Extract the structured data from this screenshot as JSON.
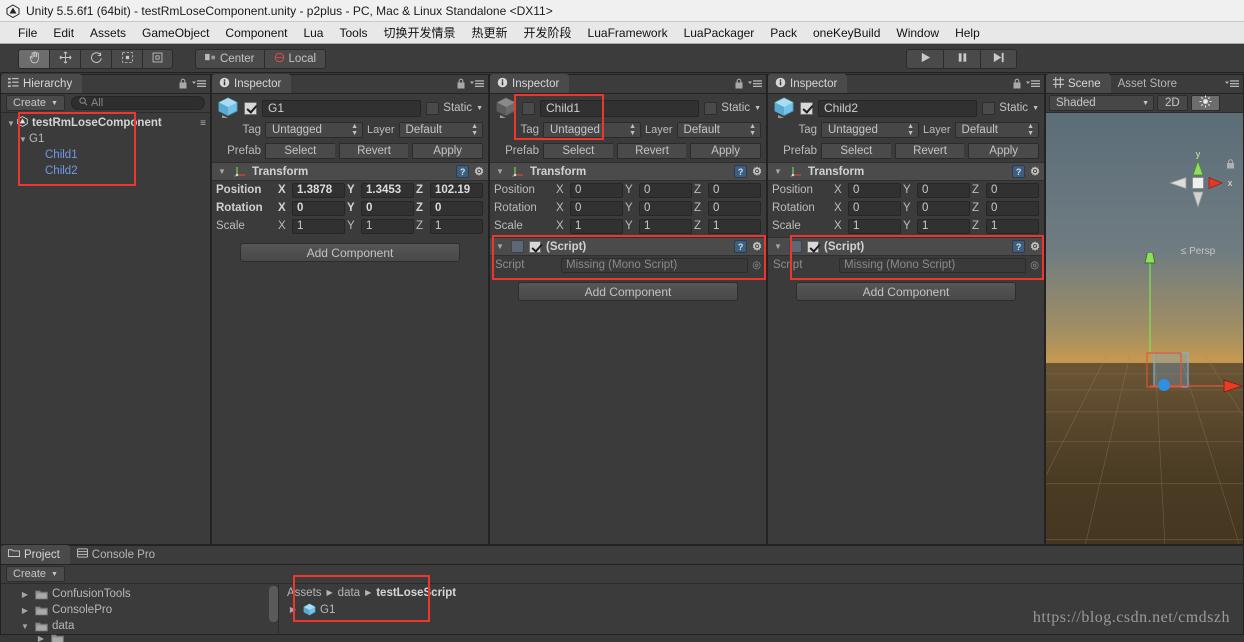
{
  "window": {
    "title": "Unity 5.5.6f1 (64bit) - testRmLoseComponent.unity - p2plus - PC, Mac & Linux Standalone <DX11>",
    "logo_icon": "unity-logo-icon"
  },
  "menu": {
    "items": [
      "File",
      "Edit",
      "Assets",
      "GameObject",
      "Component",
      "Lua",
      "Tools",
      "切换开发情景",
      "热更新",
      "开发阶段",
      "LuaFramework",
      "LuaPackager",
      "Pack",
      "oneKeyBuild",
      "Window",
      "Help"
    ]
  },
  "toolbar": {
    "tools": [
      {
        "name": "hand-tool",
        "icon": "hand-icon",
        "active": true
      },
      {
        "name": "move-tool",
        "icon": "move-arrows-icon",
        "active": false
      },
      {
        "name": "rotate-tool",
        "icon": "rotate-icon",
        "active": false
      },
      {
        "name": "scale-tool",
        "icon": "scale-icon",
        "active": false
      },
      {
        "name": "rect-tool",
        "icon": "rect-transform-icon",
        "active": false
      }
    ],
    "pivot_label": "Center",
    "pivot_icon": "pivot-center-icon",
    "rotation_label": "Local",
    "rotation_icon": "local-rotation-icon",
    "play_label": "play-icon",
    "pause_label": "pause-icon",
    "step_label": "step-icon"
  },
  "hierarchy": {
    "tab_label": "Hierarchy",
    "tab_icon": "hierarchy-icon",
    "create_label": "Create",
    "search_placeholder": "All",
    "search_icon": "search-icon",
    "lock_icon": "lock-icon",
    "menu_icon": "panel-menu-icon",
    "scene_name": "testRmLoseComponent",
    "scene_icon": "unity-scene-icon",
    "nodes": [
      {
        "label": "G1",
        "depth": 1,
        "expanded": true,
        "prefab": false
      },
      {
        "label": "Child1",
        "depth": 2,
        "expanded": false,
        "prefab": true
      },
      {
        "label": "Child2",
        "depth": 2,
        "expanded": false,
        "prefab": true
      }
    ]
  },
  "inspectors": [
    {
      "tab_label": "Inspector",
      "tab_icon": "info-icon",
      "object_name": "G1",
      "enabled": true,
      "static_label": "Static",
      "static_checked": false,
      "tag_label": "Tag",
      "tag_value": "Untagged",
      "layer_label": "Layer",
      "layer_value": "Default",
      "prefab_label": "Prefab",
      "prefab_buttons": [
        "Select",
        "Revert",
        "Apply"
      ],
      "transform": {
        "title": "Transform",
        "icon": "transform-axis-icon",
        "rows": [
          {
            "label": "Position",
            "x": "1.3878",
            "y": "1.3453",
            "z": "102.19",
            "highlight": true
          },
          {
            "label": "Rotation",
            "x": "0",
            "y": "0",
            "z": "0",
            "highlight": true
          },
          {
            "label": "Scale",
            "x": "1",
            "y": "1",
            "z": "1",
            "highlight": false
          }
        ]
      },
      "script_component": null,
      "add_component_label": "Add Component"
    },
    {
      "tab_label": "Inspector",
      "tab_icon": "info-icon",
      "object_name": "Child1",
      "enabled": false,
      "static_label": "Static",
      "static_checked": false,
      "tag_label": "Tag",
      "tag_value": "Untagged",
      "layer_label": "Layer",
      "layer_value": "Default",
      "prefab_label": "Prefab",
      "prefab_buttons": [
        "Select",
        "Revert",
        "Apply"
      ],
      "transform": {
        "title": "Transform",
        "icon": "transform-axis-icon",
        "rows": [
          {
            "label": "Position",
            "x": "0",
            "y": "0",
            "z": "0",
            "highlight": false
          },
          {
            "label": "Rotation",
            "x": "0",
            "y": "0",
            "z": "0",
            "highlight": false
          },
          {
            "label": "Scale",
            "x": "1",
            "y": "1",
            "z": "1",
            "highlight": false
          }
        ]
      },
      "script_component": {
        "title": "(Script)",
        "enabled": true,
        "field_label": "Script",
        "field_value": "Missing (Mono Script)"
      },
      "add_component_label": "Add Component"
    },
    {
      "tab_label": "Inspector",
      "tab_icon": "info-icon",
      "object_name": "Child2",
      "enabled": true,
      "static_label": "Static",
      "static_checked": false,
      "tag_label": "Tag",
      "tag_value": "Untagged",
      "layer_label": "Layer",
      "layer_value": "Default",
      "prefab_label": "Prefab",
      "prefab_buttons": [
        "Select",
        "Revert",
        "Apply"
      ],
      "transform": {
        "title": "Transform",
        "icon": "transform-axis-icon",
        "rows": [
          {
            "label": "Position",
            "x": "0",
            "y": "0",
            "z": "0",
            "highlight": false
          },
          {
            "label": "Rotation",
            "x": "0",
            "y": "0",
            "z": "0",
            "highlight": false
          },
          {
            "label": "Scale",
            "x": "1",
            "y": "1",
            "z": "1",
            "highlight": false
          }
        ]
      },
      "script_component": {
        "title": "(Script)",
        "enabled": true,
        "field_label": "Script",
        "field_value": "Missing (Mono Script)"
      },
      "add_component_label": "Add Component"
    }
  ],
  "scene": {
    "tab_label": "Scene",
    "tab_icon": "scene-grid-icon",
    "asset_store_tab": "Asset Store",
    "shading_mode": "Shaded",
    "toggle_2d": "2D",
    "light_icon": "lighting-icon",
    "audio_icon": "audio-icon",
    "perspective_label": "Persp",
    "gizmo_axes": {
      "x": "x",
      "y": "y"
    },
    "lock_icon": "lock-icon"
  },
  "project": {
    "tab_label": "Project",
    "tab_icon": "folder-icon",
    "console_tab": "Console Pro",
    "console_icon": "console-icon",
    "create_label": "Create",
    "tree": [
      {
        "label": "ConfusionTools",
        "expanded": false,
        "depth": 1
      },
      {
        "label": "ConsolePro",
        "expanded": false,
        "depth": 1
      },
      {
        "label": "data",
        "expanded": true,
        "depth": 1
      }
    ],
    "breadcrumb": [
      "Assets",
      "data",
      "testLoseScript"
    ],
    "assets": [
      {
        "label": "G1",
        "icon": "prefab-cube-icon",
        "expandable": true
      }
    ]
  },
  "watermark": "https://blog.csdn.net/cmdszh",
  "colors": {
    "annotation_red": "#f0352e",
    "panel_bg": "#3b3b3b",
    "chrome_bg": "#3c3c3c",
    "prefab_blue": "#6f9ae8"
  }
}
